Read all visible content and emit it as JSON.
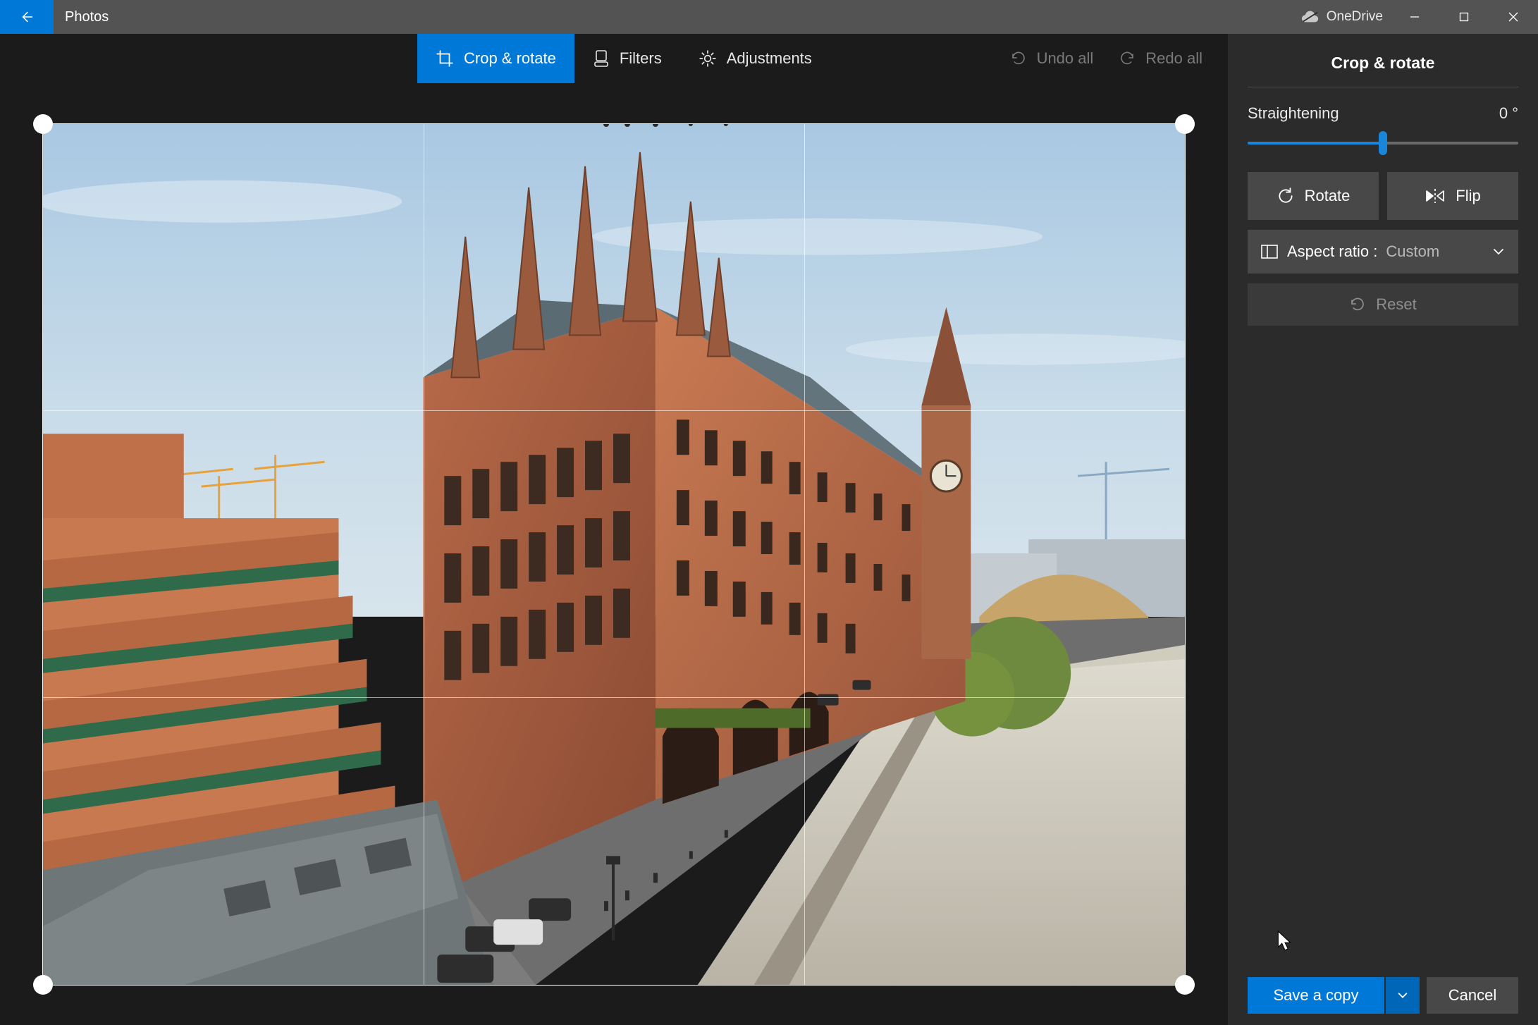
{
  "titlebar": {
    "app_title": "Photos",
    "onedrive_label": "OneDrive"
  },
  "toolbar": {
    "crop_label": "Crop & rotate",
    "filters_label": "Filters",
    "adjustments_label": "Adjustments",
    "undo_label": "Undo all",
    "redo_label": "Redo all"
  },
  "panel": {
    "title": "Crop & rotate",
    "straightening_label": "Straightening",
    "straightening_value": "0 °",
    "rotate_label": "Rotate",
    "flip_label": "Flip",
    "aspect_label": "Aspect ratio : ",
    "aspect_value": "Custom",
    "reset_label": "Reset",
    "save_label": "Save a copy",
    "cancel_label": "Cancel"
  }
}
